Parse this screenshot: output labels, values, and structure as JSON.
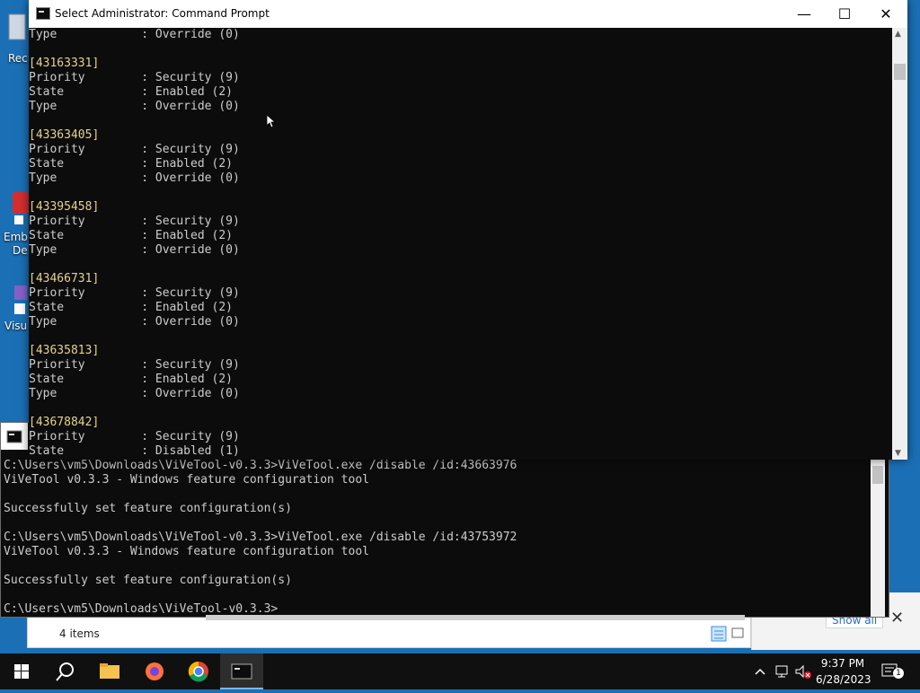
{
  "desktop": {
    "icons": [
      {
        "label": "Rec"
      },
      {
        "label": "Emb"
      },
      {
        "label": "De"
      },
      {
        "label": "Visu"
      }
    ]
  },
  "front_console": {
    "title": "Select Administrator:  Command Prompt",
    "lines": [
      {
        "text": "Type            : Override (0)",
        "kind": "field"
      },
      {
        "text": "",
        "kind": "blank"
      },
      {
        "text": "[43163331]",
        "kind": "id"
      },
      {
        "text": "Priority        : Security (9)",
        "kind": "field"
      },
      {
        "text": "State           : Enabled (2)",
        "kind": "field"
      },
      {
        "text": "Type            : Override (0)",
        "kind": "field"
      },
      {
        "text": "",
        "kind": "blank"
      },
      {
        "text": "[43363405]",
        "kind": "id"
      },
      {
        "text": "Priority        : Security (9)",
        "kind": "field"
      },
      {
        "text": "State           : Enabled (2)",
        "kind": "field"
      },
      {
        "text": "Type            : Override (0)",
        "kind": "field"
      },
      {
        "text": "",
        "kind": "blank"
      },
      {
        "text": "[43395458]",
        "kind": "id"
      },
      {
        "text": "Priority        : Security (9)",
        "kind": "field"
      },
      {
        "text": "State           : Enabled (2)",
        "kind": "field"
      },
      {
        "text": "Type            : Override (0)",
        "kind": "field"
      },
      {
        "text": "",
        "kind": "blank"
      },
      {
        "text": "[43466731]",
        "kind": "id"
      },
      {
        "text": "Priority        : Security (9)",
        "kind": "field"
      },
      {
        "text": "State           : Enabled (2)",
        "kind": "field"
      },
      {
        "text": "Type            : Override (0)",
        "kind": "field"
      },
      {
        "text": "",
        "kind": "blank"
      },
      {
        "text": "[43635813]",
        "kind": "id"
      },
      {
        "text": "Priority        : Security (9)",
        "kind": "field"
      },
      {
        "text": "State           : Enabled (2)",
        "kind": "field"
      },
      {
        "text": "Type            : Override (0)",
        "kind": "field"
      },
      {
        "text": "",
        "kind": "blank"
      },
      {
        "text": "[43678842]",
        "kind": "id"
      },
      {
        "text": "Priority        : Security (9)",
        "kind": "field"
      },
      {
        "text": "State           : Disabled (1)",
        "kind": "field"
      }
    ]
  },
  "back_console": {
    "text": "C:\\Users\\vm5\\Downloads\\ViVeTool-v0.3.3>ViVeTool.exe /disable /id:43663976\nViVeTool v0.3.3 - Windows feature configuration tool\n\nSuccessfully set feature configuration(s)\n\nC:\\Users\\vm5\\Downloads\\ViVeTool-v0.3.3>ViVeTool.exe /disable /id:43753972\nViVeTool v0.3.3 - Windows feature configuration tool\n\nSuccessfully set feature configuration(s)\n\nC:\\Users\\vm5\\Downloads\\ViVeTool-v0.3.3>"
  },
  "explorer": {
    "status": "4 items"
  },
  "notification": {
    "show_all": "Show all"
  },
  "taskbar": {
    "time": "9:37 PM",
    "date": "6/28/2023",
    "notification_count": "1"
  },
  "colors": {
    "console_bg": "#0c0c0c",
    "console_text": "#cccccc",
    "id_text": "#e5d38d",
    "desktop": "#1b6fb5",
    "taskbar": "#101010"
  }
}
